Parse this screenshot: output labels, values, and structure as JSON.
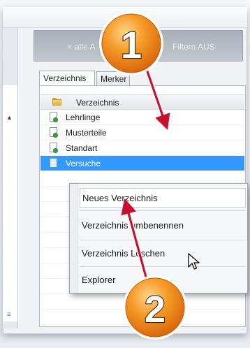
{
  "filter_bar": {
    "clear_icon": "x-icon",
    "left_text": "alle A",
    "right_text": "Filtern AUS"
  },
  "tabs": [
    {
      "label": "Verzeichnis",
      "active": true
    },
    {
      "label": "Merker",
      "active": false
    }
  ],
  "tree": {
    "header_label": "Verzeichnis",
    "header_icon": "folder-icon",
    "items": [
      {
        "label": "Lehrlinge",
        "icon": "document-add-icon",
        "selected": false
      },
      {
        "label": "Musterteile",
        "icon": "document-add-icon",
        "selected": false
      },
      {
        "label": "Standart",
        "icon": "document-add-icon",
        "selected": false
      },
      {
        "label": "Versuche",
        "icon": "document-add-icon",
        "selected": true
      }
    ]
  },
  "context_menu": {
    "items": [
      {
        "label": "Neues Verzeichnis",
        "hover": true
      },
      {
        "label": "Verzeichnis umbenennen",
        "hover": false
      },
      {
        "label": "Verzeichnis Löschen",
        "hover": false
      },
      {
        "label": "Explorer",
        "hover": false
      }
    ]
  },
  "annotations": {
    "callouts": [
      {
        "number": "1"
      },
      {
        "number": "2"
      }
    ],
    "callout_fill": "#f28a1e",
    "arrow_color": "#c8102e"
  },
  "colors": {
    "selection": "#3399ff",
    "filter_bar": "#b3b9c1"
  }
}
